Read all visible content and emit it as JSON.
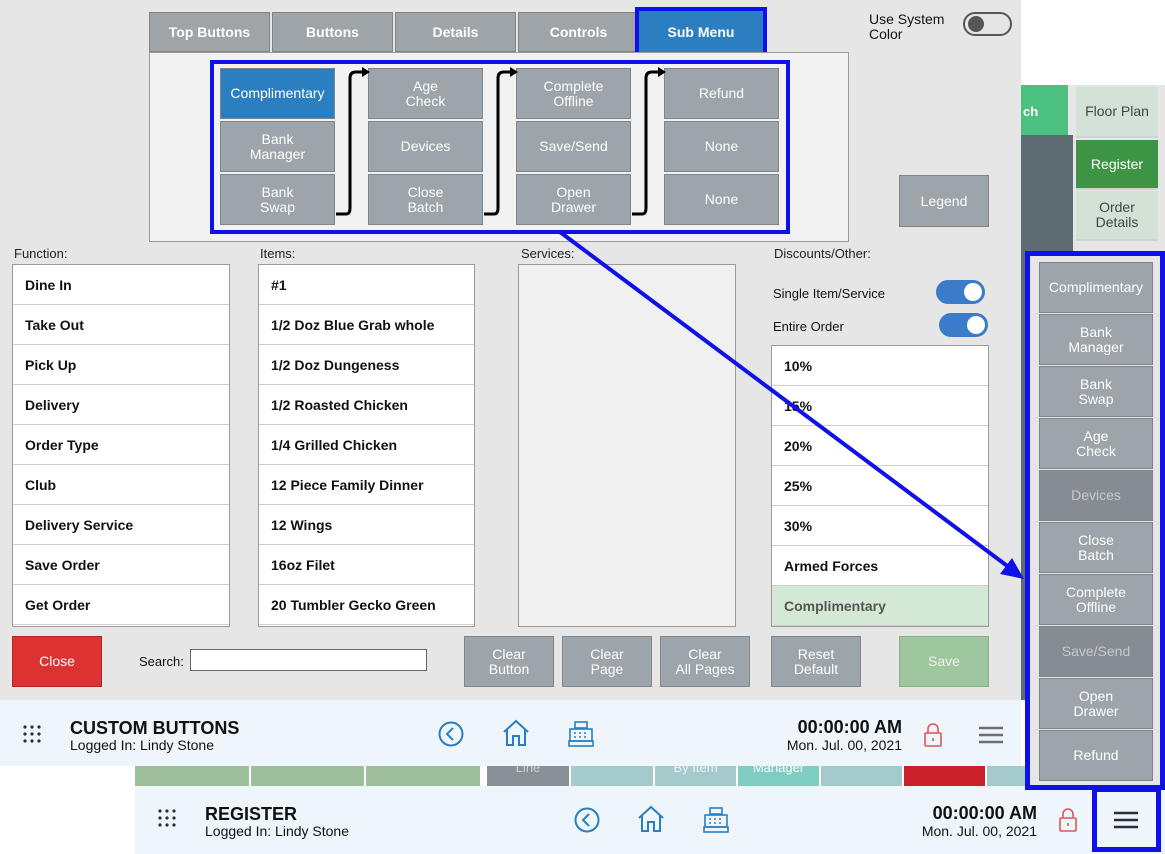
{
  "colors": {
    "accent_blue": "#2b7fc0",
    "highlight_blue": "#1010e8",
    "close_red": "#dd3232",
    "register_green": "#3d9444",
    "button_gray": "#9da4aa"
  },
  "tabs": [
    {
      "label": "Top Buttons"
    },
    {
      "label": "Buttons"
    },
    {
      "label": "Details"
    },
    {
      "label": "Controls"
    },
    {
      "label": "Sub Menu",
      "active": true
    }
  ],
  "use_system_color": {
    "label_line1": "Use System",
    "label_line2": "Color",
    "on": false
  },
  "grid": {
    "col1": [
      [
        "Complimentary",
        ""
      ],
      [
        "Bank",
        "Manager"
      ],
      [
        "Bank",
        "Swap"
      ]
    ],
    "col2": [
      [
        "Age",
        "Check"
      ],
      [
        "Devices",
        ""
      ],
      [
        "Close",
        "Batch"
      ]
    ],
    "col3": [
      [
        "Complete",
        "Offline"
      ],
      [
        "Save/Send",
        ""
      ],
      [
        "Open",
        "Drawer"
      ]
    ],
    "col4": [
      [
        "Refund",
        ""
      ],
      [
        "None",
        ""
      ],
      [
        "None",
        ""
      ]
    ]
  },
  "legend_label": "Legend",
  "columns": {
    "function": "Function:",
    "items": "Items:",
    "services": "Services:",
    "discounts": "Discounts/Other:"
  },
  "function_list": [
    "Dine In",
    "Take Out",
    "Pick Up",
    "Delivery",
    "Order Type",
    "Club",
    "Delivery Service",
    "Save Order",
    "Get Order"
  ],
  "items_list": [
    "#1",
    "1/2 Doz Blue Grab whole",
    "1/2 Doz Dungeness",
    "1/2 Roasted Chicken",
    "1/4 Grilled Chicken",
    "12 Piece Family Dinner",
    "12 Wings",
    "16oz Filet",
    "20 Tumbler Gecko Green"
  ],
  "discount_toggles": [
    {
      "label": "Single Item/Service",
      "on": true
    },
    {
      "label": "Entire Order",
      "on": true
    }
  ],
  "discount_list": [
    "10%",
    "15%",
    "20%",
    "25%",
    "30%",
    "Armed Forces",
    "Complimentary"
  ],
  "buttons": {
    "close": "Close",
    "search_label": "Search:",
    "search_value": "",
    "clear_button": [
      "Clear",
      "Button"
    ],
    "clear_page": [
      "Clear",
      "Page"
    ],
    "clear_all": [
      "Clear",
      "All Pages"
    ],
    "reset_default": [
      "Reset",
      "Default"
    ],
    "save": "Save"
  },
  "footer_custom": {
    "title": "CUSTOM BUTTONS",
    "logged_in": "Logged In:  Lindy Stone",
    "time": "00:00:00 AM",
    "date": "Mon. Jul. 00, 2021"
  },
  "footer_register": {
    "title": "REGISTER",
    "logged_in": "Logged In:  Lindy Stone",
    "time": "00:00:00 AM",
    "date": "Mon. Jul. 00, 2021"
  },
  "register_side": {
    "green_tab": "ch",
    "floor_plan": "Floor Plan",
    "register": "Register",
    "order_details": [
      "Order",
      "Details"
    ]
  },
  "bg_strip": [
    "Line",
    "By Item",
    "Manager"
  ],
  "overlay_menu": [
    {
      "l1": "Complimentary",
      "l2": "",
      "dim": false
    },
    {
      "l1": "Bank",
      "l2": "Manager",
      "dim": false
    },
    {
      "l1": "Bank",
      "l2": "Swap",
      "dim": false
    },
    {
      "l1": "Age",
      "l2": "Check",
      "dim": false
    },
    {
      "l1": "Devices",
      "l2": "",
      "dim": true
    },
    {
      "l1": "Close",
      "l2": "Batch",
      "dim": false
    },
    {
      "l1": "Complete",
      "l2": "Offline",
      "dim": false
    },
    {
      "l1": "Save/Send",
      "l2": "",
      "dim": true
    },
    {
      "l1": "Open",
      "l2": "Drawer",
      "dim": false
    },
    {
      "l1": "Refund",
      "l2": "",
      "dim": false
    }
  ]
}
